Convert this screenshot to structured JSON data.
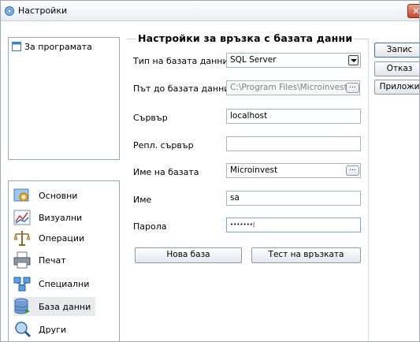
{
  "window": {
    "title": "Настройки"
  },
  "about": {
    "item_label": "За програмата"
  },
  "categories": [
    {
      "label": "Основни",
      "icon": "settings-icon"
    },
    {
      "label": "Визуални",
      "icon": "chart-icon"
    },
    {
      "label": "Операции",
      "icon": "balance-scale-icon"
    },
    {
      "label": "Печат",
      "icon": "printer-icon"
    },
    {
      "label": "Специални",
      "icon": "network-icon"
    },
    {
      "label": "База данни",
      "icon": "database-icon",
      "selected": true
    },
    {
      "label": "Други",
      "icon": "magnifier-icon"
    }
  ],
  "section": {
    "title": "Настройки за връзка с базата данни"
  },
  "form": {
    "db_type_label": "Тип на базата данни",
    "db_type_value": "SQL Server",
    "db_path_label": "Път до базата данни",
    "db_path_value": "C:\\Program Files\\Microinvest\\Warehouse",
    "server_label": "Сървър",
    "server_value": "localhost",
    "repl_server_label": "Репл. сървър",
    "repl_server_value": "",
    "db_name_label": "Име на базата",
    "db_name_value": "Microinvest",
    "user_label": "Име",
    "user_value": "sa",
    "password_label": "Парола",
    "password_value": "•••••••|",
    "browse_label": "..."
  },
  "buttons": {
    "new_db": "Нова база",
    "test_connection": "Тест на връзката",
    "save": "Запис",
    "cancel": "Отказ",
    "apply": "Приложи"
  }
}
